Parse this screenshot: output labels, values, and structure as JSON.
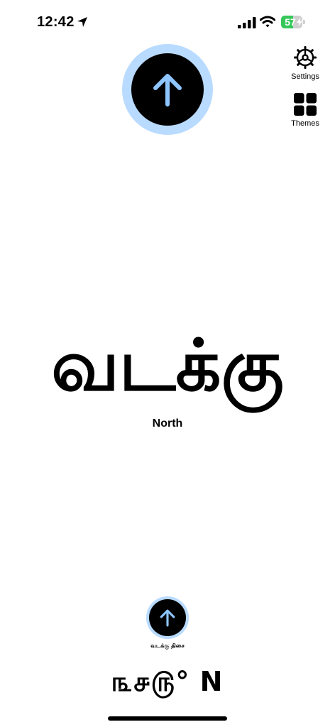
{
  "status_bar": {
    "time": "12:42",
    "battery_level": 57,
    "battery_text": "57",
    "battery_color": "#35c759",
    "icons": [
      "location-arrow-icon",
      "cellular-signal-icon",
      "wifi-icon",
      "battery-icon",
      "charging-bolt-icon"
    ]
  },
  "compass": {
    "ring_color": "#b9dbff",
    "dial_color": "#000000",
    "arrow_color": "#8ec5ff",
    "arrow_icon": "up-arrow-icon"
  },
  "toolbar": {
    "settings_label": "Settings",
    "settings_icon": "gear-icon",
    "themes_label": "Themes",
    "themes_icon": "grid-icon"
  },
  "direction": {
    "tamil": "வடக்கு",
    "english": "North"
  },
  "mini_compass": {
    "caption": "வடக்கு திசை"
  },
  "heading": {
    "value": "௩௪௫° N"
  }
}
